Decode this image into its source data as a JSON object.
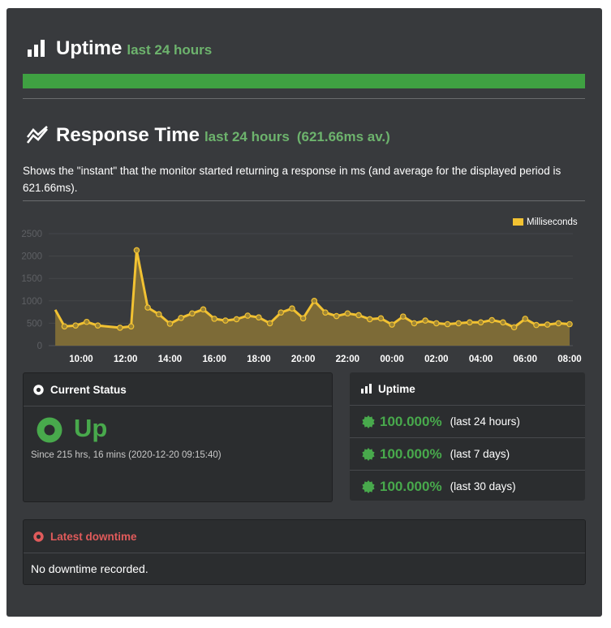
{
  "uptime_section": {
    "title": "Uptime",
    "period": "last 24 hours",
    "uptime_fraction": 1.0,
    "bar_color": "#3fa142",
    "icon": "bar-chart-icon"
  },
  "response_section": {
    "title": "Response Time",
    "period": "last 24 hours",
    "average": "(621.66ms av.)",
    "description": "Shows the \"instant\" that the monitor started returning a response in ms (and average for the displayed period is 621.66ms).",
    "icon": "line-chart-icon"
  },
  "chart_data": {
    "type": "area",
    "series": [
      {
        "name": "Milliseconds",
        "color": "#f2c232",
        "x": [
          "08:50",
          "09:15",
          "09:45",
          "10:15",
          "10:45",
          "11:45",
          "12:15",
          "12:30",
          "13:00",
          "13:30",
          "14:00",
          "14:30",
          "15:00",
          "15:30",
          "16:00",
          "16:30",
          "17:00",
          "17:30",
          "18:00",
          "18:30",
          "19:00",
          "19:30",
          "20:00",
          "20:30",
          "21:00",
          "21:30",
          "22:00",
          "22:30",
          "23:00",
          "23:30",
          "00:00",
          "00:30",
          "01:00",
          "01:30",
          "02:00",
          "02:30",
          "03:00",
          "03:30",
          "04:00",
          "04:30",
          "05:00",
          "05:30",
          "06:00",
          "06:30",
          "07:00",
          "07:30",
          "08:00"
        ],
        "values": [
          800,
          430,
          450,
          530,
          450,
          400,
          430,
          2130,
          850,
          700,
          490,
          620,
          720,
          810,
          600,
          560,
          590,
          670,
          630,
          500,
          740,
          830,
          610,
          1000,
          740,
          660,
          720,
          680,
          590,
          610,
          470,
          650,
          500,
          560,
          500,
          480,
          500,
          520,
          520,
          570,
          520,
          410,
          600,
          460,
          470,
          500,
          480
        ]
      }
    ],
    "xticks": [
      "10:00",
      "12:00",
      "14:00",
      "16:00",
      "18:00",
      "20:00",
      "22:00",
      "00:00",
      "02:00",
      "04:00",
      "06:00",
      "08:00"
    ],
    "yticks": [
      0,
      500,
      1000,
      1500,
      2000,
      2500
    ],
    "ylim": [
      0,
      2500
    ],
    "legend_position": "top-right",
    "grid": true
  },
  "current_status": {
    "title": "Current Status",
    "status": "Up",
    "since": "Since 215 hrs, 16 mins (2020-12-20 09:15:40)",
    "status_color": "#48a94c"
  },
  "uptime_card": {
    "title": "Uptime",
    "rows": [
      {
        "percent": "100.000%",
        "period": "(last 24 hours)"
      },
      {
        "percent": "100.000%",
        "period": "(last 7 days)"
      },
      {
        "percent": "100.000%",
        "period": "(last 30 days)"
      }
    ]
  },
  "latest_downtime": {
    "title": "Latest downtime",
    "message": "No downtime recorded.",
    "title_color": "#e05b5b"
  }
}
